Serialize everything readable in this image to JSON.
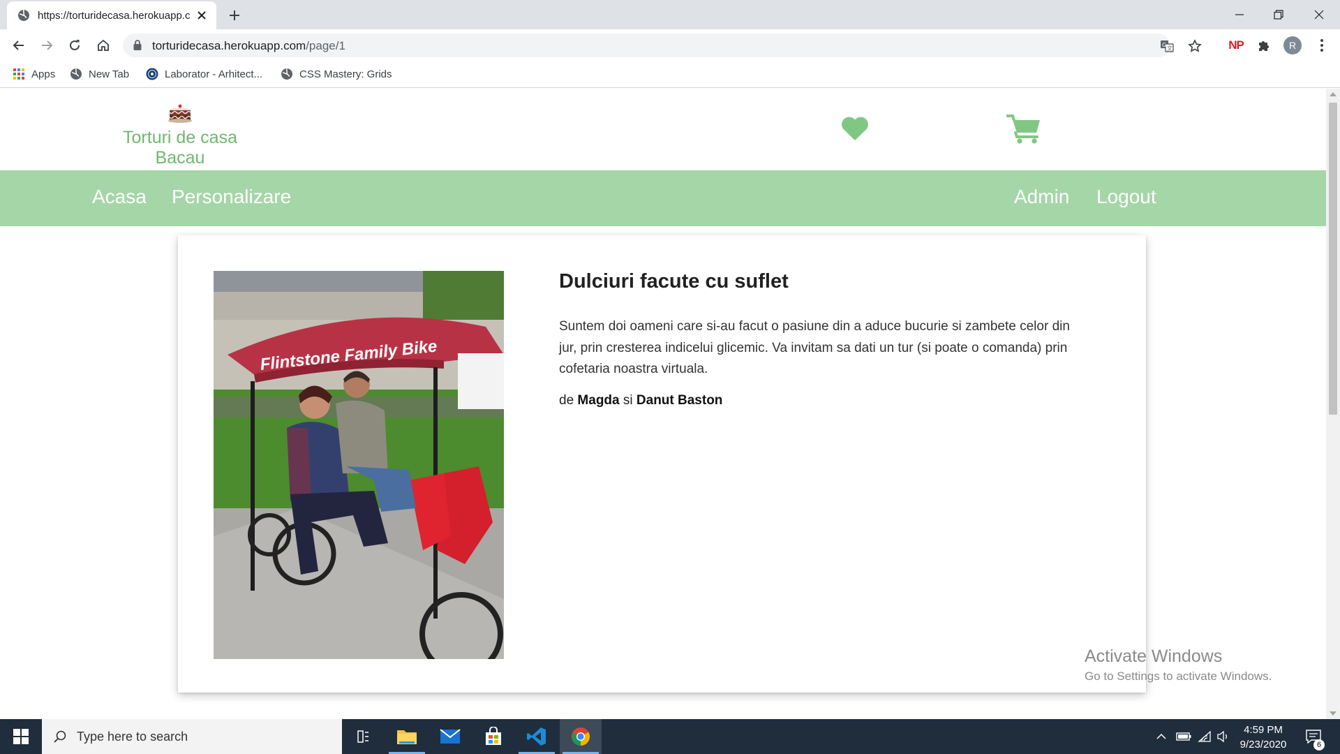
{
  "browser": {
    "tab_title": "https://torturidecasa.herokuapp.co",
    "url_host": "torturidecasa.herokuapp.com",
    "url_path": "/page/1",
    "bookmarks": [
      {
        "label": "Apps",
        "icon": "apps-grid-icon"
      },
      {
        "label": "New Tab",
        "icon": "globe-icon"
      },
      {
        "label": "Laborator - Arhitect...",
        "icon": "site-favicon-icon"
      },
      {
        "label": "CSS Mastery: Grids",
        "icon": "globe-icon"
      }
    ],
    "extension_np": "NP",
    "profile_initial": "R"
  },
  "site": {
    "brand_name": "Torturi de casa Bacau",
    "accent_color": "#a5d6a7",
    "brand_color": "#6fb86f",
    "nav": {
      "home": "Acasa",
      "customize": "Personalizare",
      "admin": "Admin",
      "logout": "Logout"
    }
  },
  "card": {
    "photo_caption": "Flintstone Family Bike",
    "title": "Dulciuri facute cu suflet",
    "text": "Suntem doi oameni care si-au facut o pasiune din a aduce bucurie si zambete celor din jur, prin cresterea indicelui glicemic. Va invitam sa dati un tur (si poate o comanda) prin cofetaria noastra virtuala.",
    "sig_prefix": "de",
    "author1": "Magda",
    "sig_and": "si",
    "author2": "Danut Baston"
  },
  "watermark": {
    "line1": "Activate Windows",
    "line2": "Go to Settings to activate Windows."
  },
  "taskbar": {
    "search_placeholder": "Type here to search",
    "time": "4:59 PM",
    "date": "9/23/2020",
    "notifications": "6"
  }
}
